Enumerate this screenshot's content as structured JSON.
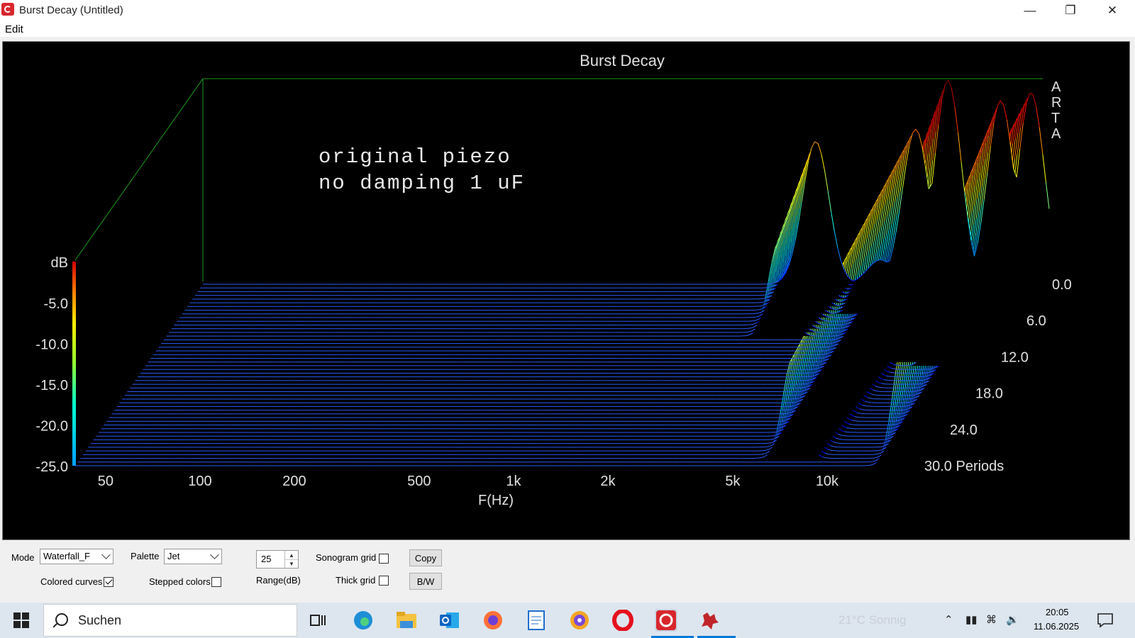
{
  "window": {
    "title": "Burst Decay  (Untitled)"
  },
  "menu": {
    "items": [
      "Edit"
    ]
  },
  "chart": {
    "title": "Burst Decay",
    "annotation_line1": "original piezo",
    "annotation_line2": "no damping 1 uF",
    "watermark": [
      "A",
      "R",
      "T",
      "A"
    ]
  },
  "chart_data": {
    "type": "waterfall",
    "title": "Burst Decay",
    "xlabel": "F(Hz)",
    "x_ticks": [
      "50",
      "100",
      "200",
      "500",
      "1k",
      "2k",
      "5k",
      "10k"
    ],
    "x_scale": "log",
    "xlim": [
      40,
      20000
    ],
    "zlabel": "dB",
    "z_ticks": [
      "-5.0",
      "-10.0",
      "-15.0",
      "-20.0",
      "-25.0"
    ],
    "zlim": [
      -25,
      0
    ],
    "depth_label": "Periods",
    "depth_ticks": [
      "0.0",
      "6.0",
      "12.0",
      "18.0",
      "24.0",
      "30.0 Periods"
    ],
    "depth_range": [
      0,
      30
    ],
    "slices": 50,
    "palette": "Jet",
    "colored_curves": true,
    "peaks": [
      {
        "freq_hz": 3600,
        "level_db": -7.5,
        "decay_periods": 9
      },
      {
        "freq_hz": 7500,
        "level_db": -6.0,
        "decay_periods": 29
      },
      {
        "freq_hz": 9500,
        "level_db": 0.0,
        "decay_periods": 13
      },
      {
        "freq_hz": 14000,
        "level_db": -2.5,
        "decay_periods": 14
      },
      {
        "freq_hz": 17500,
        "level_db": -1.5,
        "decay_periods": 30
      },
      {
        "freq_hz": 5800,
        "level_db": -22.0,
        "decay_periods": 5
      }
    ]
  },
  "controls": {
    "mode_label": "Mode",
    "mode_value": "Waterfall_F",
    "palette_label": "Palette",
    "palette_value": "Jet",
    "range_value": "25",
    "range_label": "Range(dB)",
    "sonogram_grid_label": "Sonogram grid",
    "sonogram_grid_checked": false,
    "colored_curves_label": "Colored curves",
    "colored_curves_checked": true,
    "stepped_colors_label": "Stepped colors",
    "stepped_colors_checked": false,
    "thick_grid_label": "Thick grid",
    "thick_grid_checked": false,
    "copy_label": "Copy",
    "bw_label": "B/W"
  },
  "taskbar": {
    "search_placeholder": "Suchen",
    "weather": "21°C  Sonnig",
    "time": "20:05",
    "date": "11.06.2025",
    "apps": [
      "task-view",
      "edge",
      "file-explorer",
      "outlook",
      "firefox",
      "notepad",
      "brave",
      "opera",
      "arta",
      "limp"
    ]
  }
}
